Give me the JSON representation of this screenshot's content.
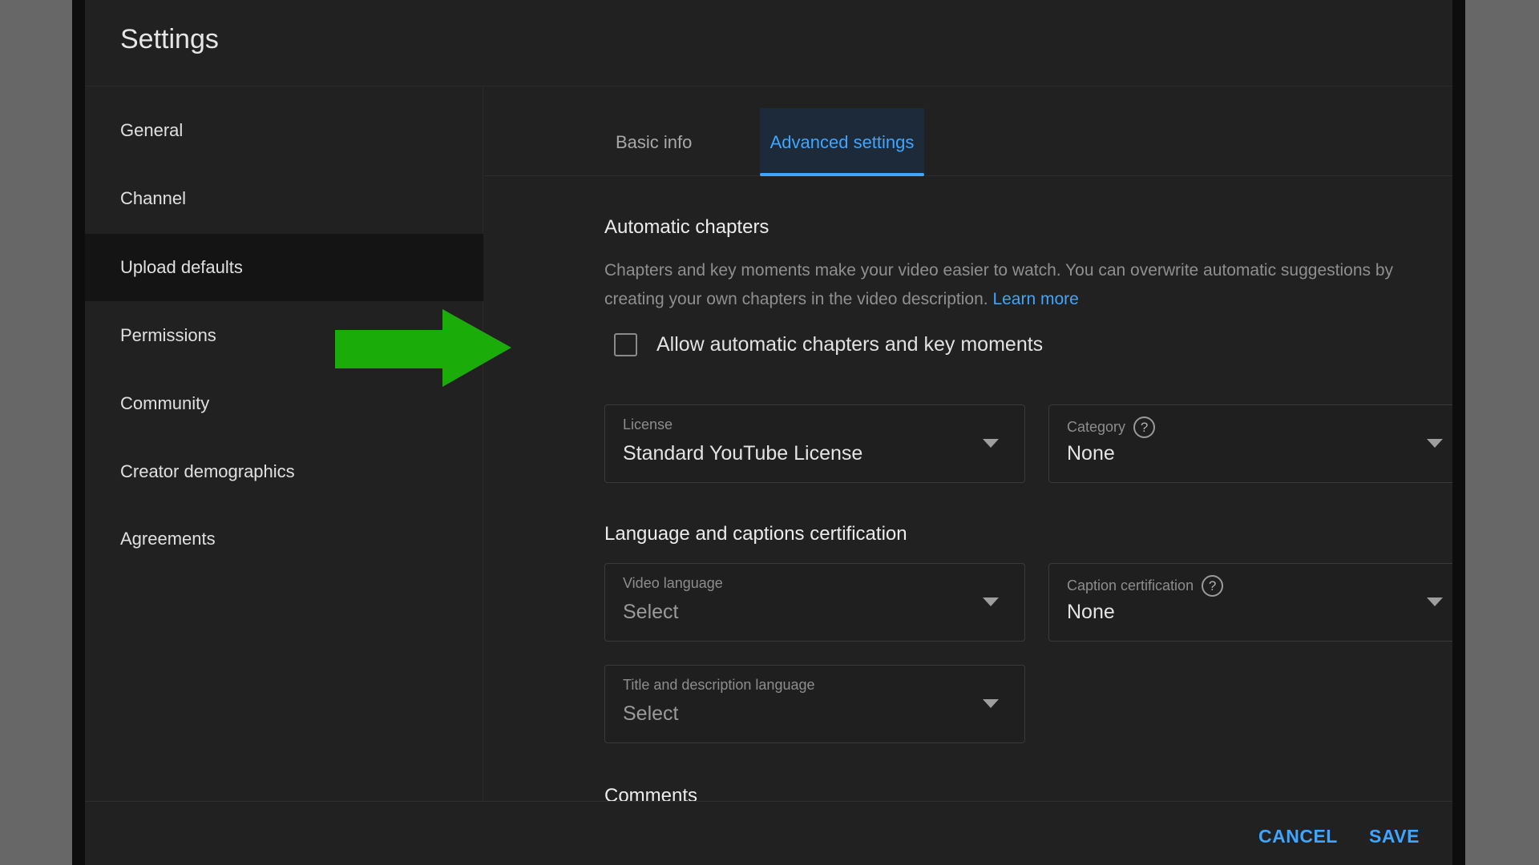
{
  "dialog": {
    "title": "Settings"
  },
  "sidebar": {
    "items": [
      {
        "label": "General",
        "active": false
      },
      {
        "label": "Channel",
        "active": false
      },
      {
        "label": "Upload defaults",
        "active": true
      },
      {
        "label": "Permissions",
        "active": false
      },
      {
        "label": "Community",
        "active": false
      },
      {
        "label": "Creator demographics",
        "active": false
      },
      {
        "label": "Agreements",
        "active": false
      }
    ]
  },
  "tabs": [
    {
      "label": "Basic info",
      "active": false
    },
    {
      "label": "Advanced settings",
      "active": true
    }
  ],
  "automatic_chapters": {
    "heading": "Automatic chapters",
    "description": "Chapters and key moments make your video easier to watch. You can overwrite automatic suggestions by creating your own chapters in the video description.",
    "learn_more": "Learn more",
    "checkbox_label": "Allow automatic chapters and key moments",
    "checked": false
  },
  "fields": {
    "license": {
      "label": "License",
      "value": "Standard YouTube License"
    },
    "category": {
      "label": "Category",
      "value": "None",
      "help_icon": "?"
    },
    "video_language": {
      "label": "Video language",
      "value": "Select"
    },
    "caption_certification": {
      "label": "Caption certification",
      "value": "None",
      "help_icon": "?"
    },
    "title_description_language": {
      "label": "Title and description language",
      "value": "Select"
    }
  },
  "language_section": {
    "heading": "Language and captions certification"
  },
  "comments_section": {
    "heading": "Comments"
  },
  "footer": {
    "cancel_label": "CANCEL",
    "save_label": "SAVE"
  },
  "annotation": {
    "arrow_color": "#1aad0a",
    "points_to": "Allow automatic chapters and key moments"
  },
  "colors": {
    "accent": "#3ea6ff",
    "dialog_bg": "#212121",
    "backdrop": "#676767"
  }
}
